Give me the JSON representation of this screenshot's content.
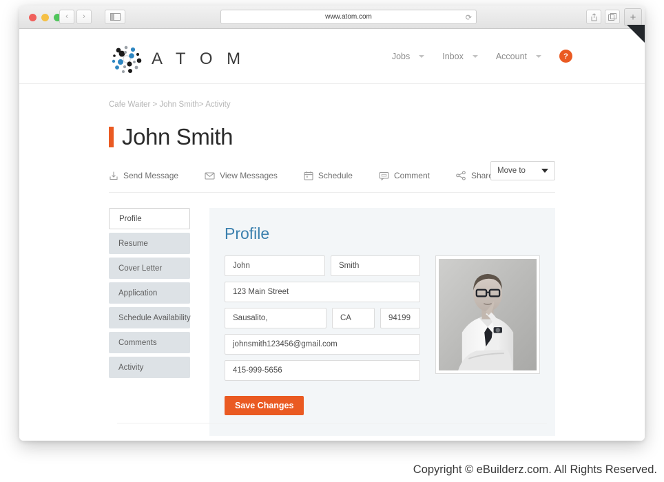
{
  "browser": {
    "url": "www.atom.com",
    "reload_icon": "reload-icon",
    "back_glyph": "‹",
    "forward_glyph": "›",
    "plus_glyph": "+"
  },
  "header": {
    "logo_text": "A T O M",
    "nav": [
      {
        "label": "Jobs"
      },
      {
        "label": "Inbox"
      },
      {
        "label": "Account"
      }
    ],
    "help_label": "?"
  },
  "breadcrumb": "Cafe Waiter > John Smith> Activity",
  "page_title": "John Smith",
  "actions": [
    {
      "label": "Send Message",
      "icon": "send-message-icon"
    },
    {
      "label": "View Messages",
      "icon": "envelope-icon"
    },
    {
      "label": "Schedule",
      "icon": "calendar-icon"
    },
    {
      "label": "Comment",
      "icon": "comment-icon"
    },
    {
      "label": "Share",
      "icon": "share-icon"
    }
  ],
  "move_to": {
    "label": "Move to"
  },
  "sidebar": {
    "items": [
      {
        "label": "Profile"
      },
      {
        "label": "Resume"
      },
      {
        "label": "Cover Letter"
      },
      {
        "label": "Application"
      },
      {
        "label": "Schedule Availability"
      },
      {
        "label": "Comments"
      },
      {
        "label": "Activity"
      }
    ]
  },
  "profile": {
    "title": "Profile",
    "first_name": "John",
    "last_name": "Smith",
    "address": "123 Main Street",
    "city": "Sausalito,",
    "state": "CA",
    "zip": "94199",
    "email": "johnsmith123456@gmail.com",
    "phone": "415-999-5656",
    "save_label": "Save Changes"
  },
  "footer": "Copyright © eBuilderz.com. All Rights Reserved.",
  "colors": {
    "accent_orange": "#ea5a22",
    "title_blue": "#3b80ae",
    "card_bg": "#f3f6f8",
    "sidebar_bg": "#dde2e6"
  }
}
